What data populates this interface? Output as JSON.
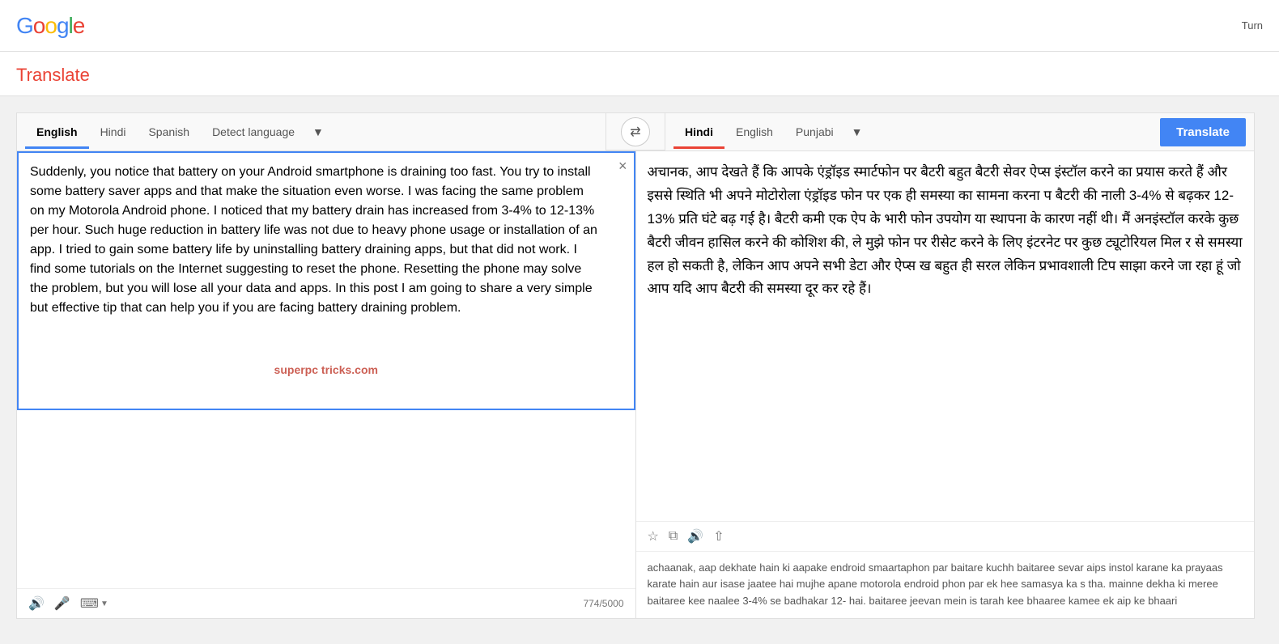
{
  "header": {
    "logo": "Google",
    "logo_parts": [
      "G",
      "o",
      "o",
      "g",
      "l",
      "e"
    ],
    "right_text": "Turn"
  },
  "page_title": "Translate",
  "source_lang_tabs": [
    {
      "label": "English",
      "active": true
    },
    {
      "label": "Hindi",
      "active": false
    },
    {
      "label": "Spanish",
      "active": false
    },
    {
      "label": "Detect language",
      "active": false
    }
  ],
  "target_lang_tabs": [
    {
      "label": "Hindi",
      "active": true
    },
    {
      "label": "English",
      "active": false
    },
    {
      "label": "Punjabi",
      "active": false
    }
  ],
  "swap_icon": "⇄",
  "translate_button_label": "Translate",
  "input_text": "Suddenly, you notice that battery on your Android smartphone is draining too fast. You try to install some battery saver apps and that make the situation even worse. I was facing the same problem on my Motorola Android phone. I noticed that my battery drain has increased from 3-4% to 12-13% per hour. Such huge reduction in battery life was not due to heavy phone usage or installation of an app. I tried to gain some battery life by uninstalling battery draining apps, but that did not work. I find some tutorials on the Internet suggesting to reset the phone. Resetting the phone may solve the problem, but you will lose all your data and apps. In this post I am going to share a very simple but effective tip that can help you if you are facing battery draining problem.",
  "char_count": "774/5000",
  "clear_icon": "×",
  "sound_icon": "🔊",
  "mic_icon": "🎤",
  "keyboard_icon": "⌨",
  "dropdown_icon": "▼",
  "watermark": "superpc tricks.com",
  "output_hindi": "अचानक, आप देखते हैं कि आपके एंड्रॉइड स्मार्टफोन पर बैटरी बहुत बैटरी सेवर ऐप्स इंस्टॉल करने का प्रयास करते हैं और इससे स्थिति भी अपने मोटोरोला एंड्रॉइड फोन पर एक ही समस्या का सामना करना प बैटरी की नाली 3-4% से बढ़कर 12-13% प्रति घंटे बढ़ गई है। बैटरी कमी एक ऐप के भारी फोन उपयोग या स्थापना के कारण नहीं थी। मैं अनइंस्टॉल करके कुछ बैटरी जीवन हासिल करने की कोशिश की, ले मुझे फोन पर रीसेट करने के लिए इंटरनेट पर कुछ ट्यूटोरियल मिल र से समस्या हल हो सकती है, लेकिन आप अपने सभी डेटा और ऐप्स ख बहुत ही सरल लेकिन प्रभावशाली टिप साझा करने जा रहा हूं जो आप यदि आप बैटरी की समस्या दूर कर रहे हैं।",
  "output_romanized": "achaanak, aap dekhate hain ki aapake endroid smaartaphon par baitare kuchh baitaree sevar aips instol karane ka prayaas karate hain aur isase jaatee hai mujhe apane motorola endroid phon par ek hee samasya ka s tha. mainne dekha ki meree baitaree kee naalee 3-4% se badhakar 12- hai. baitaree jeevan mein is tarah kee bhaaree kamee ek aip ke bhaari",
  "star_icon": "☆",
  "copy_icon": "⧉",
  "share_icon": "⇧"
}
